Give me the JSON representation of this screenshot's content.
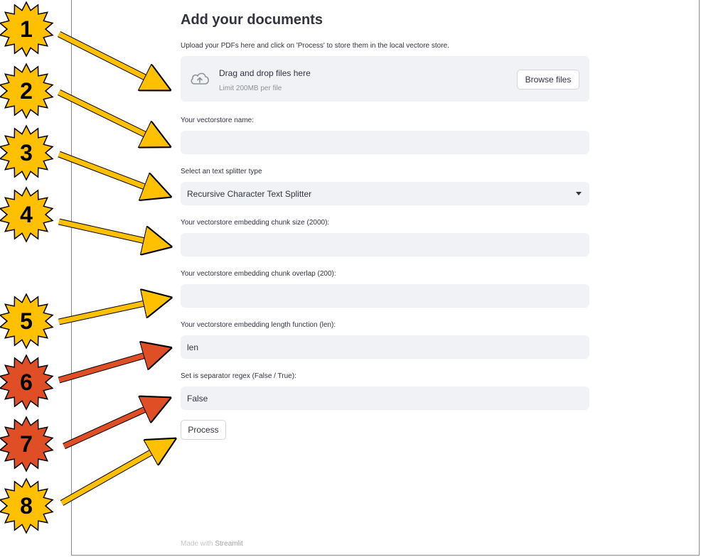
{
  "page": {
    "title": "Add your documents",
    "subtitle": "Upload your PDFs here and click on 'Process' to store them in the local vectore store."
  },
  "uploader": {
    "icon": "cloud-upload-icon",
    "main_text": "Drag and drop files here",
    "limit_text": "Limit 200MB per file",
    "browse_label": "Browse files"
  },
  "fields": {
    "vectorstore_name": {
      "label": "Your vectorstore name:",
      "value": ""
    },
    "splitter_type": {
      "label": "Select an text splitter type",
      "value": "Recursive Character Text Splitter"
    },
    "chunk_size": {
      "label": "Your vectorstore embedding chunk size (2000):",
      "value": ""
    },
    "chunk_overlap": {
      "label": "Your vectorstore embedding chunk overlap (200):",
      "value": ""
    },
    "length_function": {
      "label": "Your vectorstore embedding length function (len):",
      "value": "len"
    },
    "separator_regex": {
      "label": "Set is separator regex (False / True):",
      "value": "False"
    }
  },
  "process_label": "Process",
  "footer": {
    "prefix": "Made with ",
    "link": "Streamlit"
  },
  "markers": [
    "1",
    "2",
    "3",
    "4",
    "5",
    "6",
    "7",
    "8"
  ],
  "colors": {
    "field_bg": "#f0f2f6",
    "text": "#31333f",
    "marker_yellow": "#ffc000",
    "marker_orange": "#e04e26",
    "arrow_yellow": "#ffc000",
    "arrow_orange": "#e04e26"
  }
}
